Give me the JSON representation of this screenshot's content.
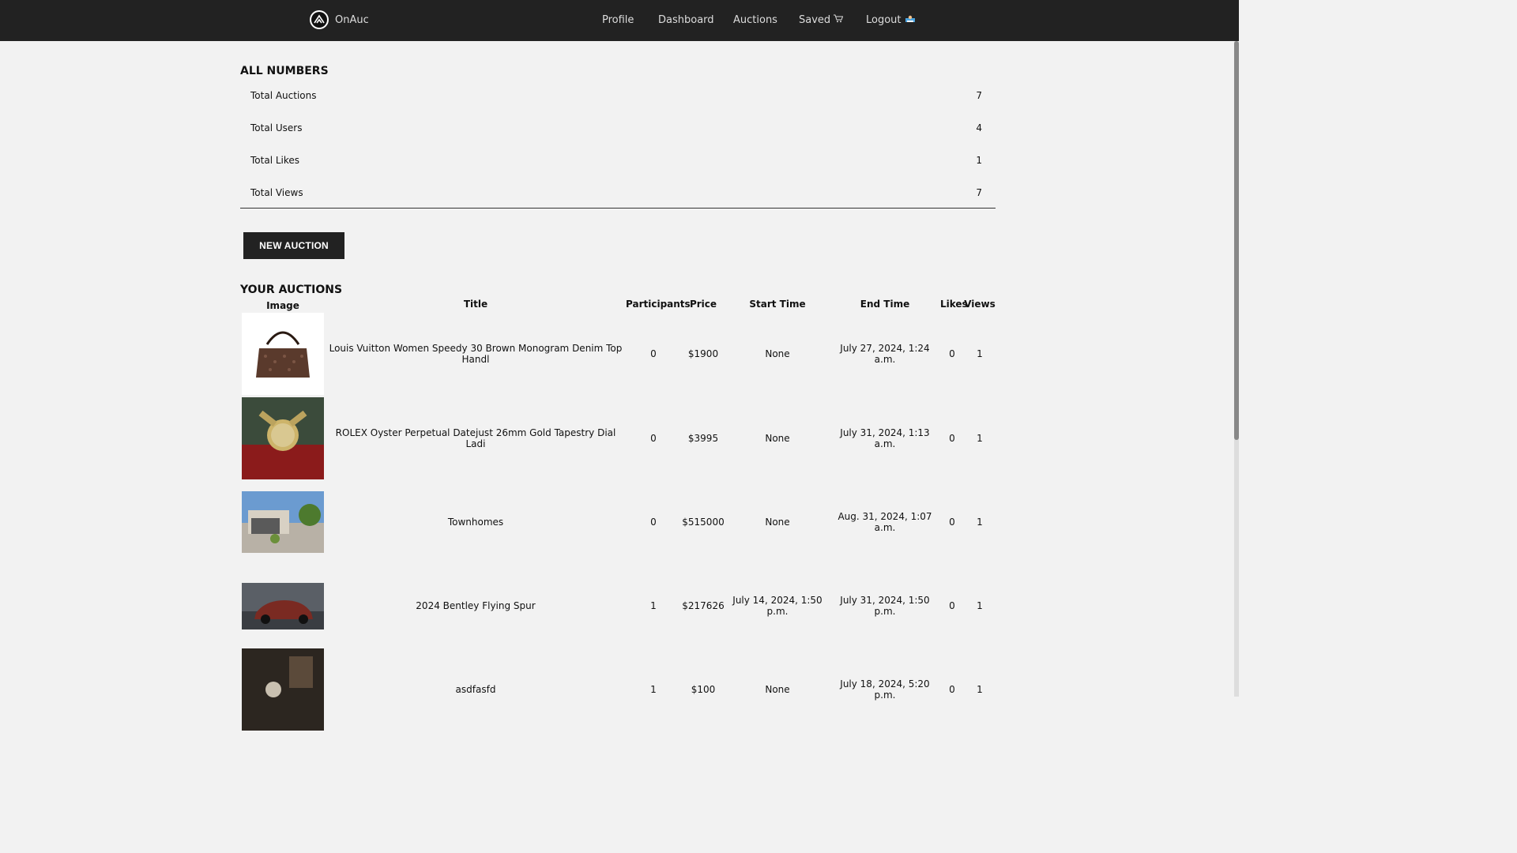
{
  "nav": {
    "brand": "OnAuc",
    "items": [
      {
        "label": "Profile"
      },
      {
        "label": "Dashboard"
      },
      {
        "label": "Auctions"
      },
      {
        "label": "Saved"
      },
      {
        "label": "Logout"
      }
    ],
    "saved_icon": "cart-icon",
    "logout_icon": "logout-icon"
  },
  "stats": {
    "title": "ALL NUMBERS",
    "rows": [
      {
        "label": "Total Auctions",
        "value": "7"
      },
      {
        "label": "Total Users",
        "value": "4"
      },
      {
        "label": "Total Likes",
        "value": "1"
      },
      {
        "label": "Total Views",
        "value": "7"
      }
    ]
  },
  "new_auction_label": "NEW AUCTION",
  "auctions": {
    "title": "YOUR AUCTIONS",
    "headers": {
      "image": "Image",
      "title": "Title",
      "participants": "Participants",
      "price": "Price",
      "start": "Start Time",
      "end": "End Time",
      "likes": "Likes",
      "views": "Views"
    },
    "rows": [
      {
        "title": "Louis Vuitton Women Speedy 30 Brown Monogram Denim Top Handl",
        "participants": "0",
        "price": "$1900",
        "start": "None",
        "end": "July 27, 2024, 1:24 a.m.",
        "likes": "0",
        "views": "1",
        "image": "handbag"
      },
      {
        "title": "ROLEX Oyster Perpetual Datejust 26mm Gold Tapestry Dial Ladi",
        "participants": "0",
        "price": "$3995",
        "start": "None",
        "end": "July 31, 2024, 1:13 a.m.",
        "likes": "0",
        "views": "1",
        "image": "watch"
      },
      {
        "title": "Townhomes",
        "participants": "0",
        "price": "$515000",
        "start": "None",
        "end": "Aug. 31, 2024, 1:07 a.m.",
        "likes": "0",
        "views": "1",
        "image": "house"
      },
      {
        "title": "2024 Bentley Flying Spur",
        "participants": "1",
        "price": "$217626",
        "start": "July 14, 2024, 1:50 p.m.",
        "end": "July 31, 2024, 1:50 p.m.",
        "likes": "0",
        "views": "1",
        "image": "car"
      },
      {
        "title": "asdfasfd",
        "participants": "1",
        "price": "$100",
        "start": "None",
        "end": "July 18, 2024, 5:20 p.m.",
        "likes": "0",
        "views": "1",
        "image": "dark"
      }
    ]
  }
}
